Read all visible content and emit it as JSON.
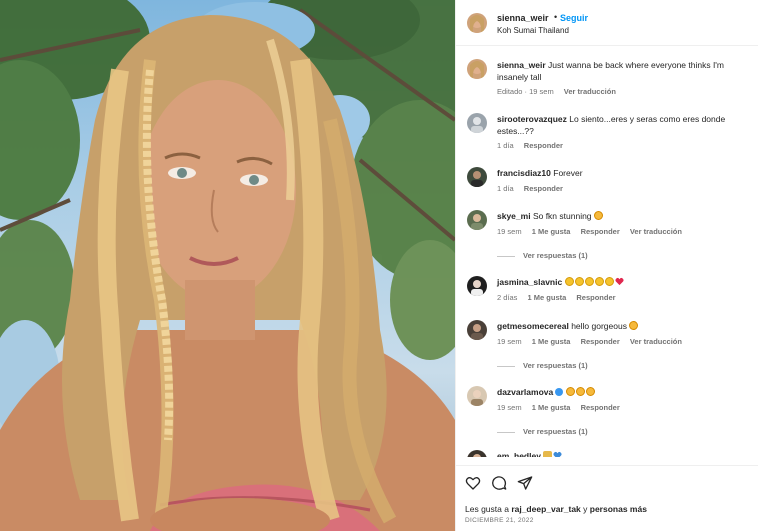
{
  "post": {
    "username": "sienna_weir",
    "dot": "•",
    "follow_label": "Seguir",
    "location": "Koh Sumai Thailand"
  },
  "caption": {
    "username": "sienna_weir",
    "text": "Just wanna be back where everyone thinks I'm insanely tall",
    "meta": {
      "edited": "Editado · 19 sem",
      "translate": "Ver traducción"
    }
  },
  "comments": [
    {
      "username": "sirooterovazquez",
      "text": "Lo siento...eres y seras como eres donde estes...??",
      "emojis": [],
      "time": "1 día",
      "likes": "",
      "reply": "Responder",
      "translate": "",
      "replies": ""
    },
    {
      "username": "francisdiaz10",
      "text": "Forever",
      "emojis": [],
      "time": "1 día",
      "likes": "",
      "reply": "Responder",
      "translate": "",
      "replies": ""
    },
    {
      "username": "skye_mi",
      "text": "So fkn stunning",
      "emojis": [
        "heart-eyes"
      ],
      "time": "19 sem",
      "likes": "1 Me gusta",
      "reply": "Responder",
      "translate": "Ver traducción",
      "replies": "Ver respuestas (1)"
    },
    {
      "username": "jasmina_slavnic",
      "text": "",
      "emojis": [
        "smile",
        "smile",
        "smile",
        "smile",
        "smile",
        "heart"
      ],
      "time": "2 días",
      "likes": "1 Me gusta",
      "reply": "Responder",
      "translate": "",
      "replies": ""
    },
    {
      "username": "getmesomecereal",
      "text": "hello gorgeous",
      "emojis": [
        "heart-eyes"
      ],
      "time": "19 sem",
      "likes": "1 Me gusta",
      "reply": "Responder",
      "translate": "Ver traducción",
      "replies": "Ver respuestas (1)"
    },
    {
      "username": "dazvarlamova",
      "text": "",
      "emojis": [
        "heart-eyes",
        "heart-eyes",
        "heart-eyes"
      ],
      "verified": true,
      "time": "19 sem",
      "likes": "1 Me gusta",
      "reply": "Responder",
      "translate": "",
      "replies": "Ver respuestas (1)"
    },
    {
      "username": "em_hedley",
      "text": "",
      "emojis": [
        "house",
        "blue-heart"
      ],
      "time": "",
      "likes": "",
      "reply": "",
      "translate": "",
      "replies": ""
    }
  ],
  "actions": {
    "icons": [
      "heart-icon",
      "comment-icon",
      "share-icon"
    ],
    "likes_prefix": "Les gusta a ",
    "likes_user": "raj_deep_var_tak",
    "likes_suffix": " y ",
    "likes_others": "personas más",
    "date": "DICIEMBRE 21, 2022"
  },
  "colors": {
    "link": "#0095f6",
    "meta": "#737373",
    "text": "#262626",
    "heart": "#ed4956",
    "verified": "#3897f0"
  }
}
